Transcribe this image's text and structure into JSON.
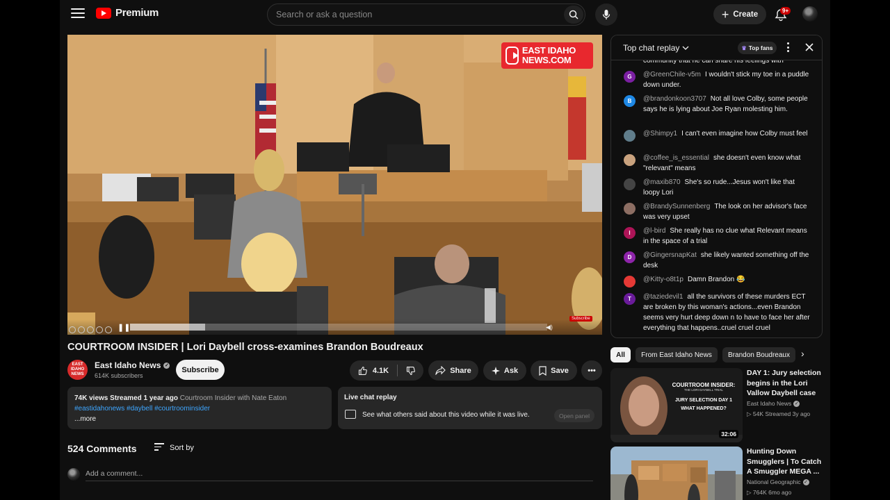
{
  "header": {
    "logo_text": "Premium",
    "search_placeholder": "Search or ask a question",
    "create_label": "Create",
    "notification_badge": "9+"
  },
  "video": {
    "brand_overlay": "EAST IDAHO NEWS.COM",
    "progress_fraction": 0.18,
    "subscribe_watermark": "Subscribe"
  },
  "title": "COURTROOM INSIDER | Lori Daybell cross-examines Brandon Boudreaux",
  "channel": {
    "name": "East Idaho News",
    "subscribers": "614K subscribers",
    "avatar_text": "EAST IDAHO NEWS"
  },
  "actions": {
    "subscribe": "Subscribe",
    "likes": "4.1K",
    "share": "Share",
    "ask": "Ask",
    "save": "Save"
  },
  "description": {
    "views": "74K views",
    "streamed": "Streamed 1 year ago",
    "series": "Courtroom Insider with Nate Eaton",
    "tags": "#eastidahonews #daybell #courtroominsider",
    "more": "...more"
  },
  "live_chat_replay": {
    "title": "Live chat replay",
    "text": "See what others said about this video while it was live.",
    "button": "Open panel"
  },
  "comments": {
    "count": "524 Comments",
    "sort_label": "Sort by",
    "add_placeholder": "Add a comment..."
  },
  "chat": {
    "title": "Top chat replay",
    "top_fans": "Top fans",
    "partial_top": "community that he can share his feelings with",
    "messages": [
      {
        "initial": "G",
        "color": "#7b1fa2",
        "author": "@GreenChile-v5m",
        "text": "I wouldn't stick my toe in a puddle down under."
      },
      {
        "initial": "B",
        "color": "#1e88e5",
        "author": "@brandonkoon3707",
        "text": "Not all love Colby, some people says he is lying about Joe Ryan molesting him."
      },
      {
        "initial": "",
        "color": "#607d8b",
        "author": "@Shimpy1",
        "text": "I can't even imagine how Colby must feel"
      },
      {
        "initial": "",
        "color": "#c9a27e",
        "author": "@coffee_is_essential",
        "text": "she doesn't even know what \"relevant\" means"
      },
      {
        "initial": "",
        "color": "#444444",
        "author": "@maxib870",
        "text": "She's so rude...Jesus won't like that loopy Lori"
      },
      {
        "initial": "",
        "color": "#8d6e63",
        "author": "@BrandySunnenberg",
        "text": "The look on her advisor's face was very upset"
      },
      {
        "initial": "I",
        "color": "#ad1457",
        "author": "@l-bird",
        "text": "She really has no clue what Relevant means in the space of a trial"
      },
      {
        "initial": "D",
        "color": "#8e24aa",
        "author": "@GingersnapKat",
        "text": "she likely wanted something off the desk"
      },
      {
        "initial": "",
        "color": "#e53935",
        "author": "@Kitty-o8t1p",
        "text": "Damn Brandon 😂"
      },
      {
        "initial": "T",
        "color": "#6a1b9a",
        "author": "@taziedevil1",
        "text": "all the survivors of these murders ECT are broken by this woman's actions...even Brandon seems very hurt deep down n to have to face her after everything that happens..cruel cruel cruel"
      }
    ]
  },
  "chips": [
    "All",
    "From East Idaho News",
    "Brandon Boudreaux"
  ],
  "related": [
    {
      "title": "DAY 1: Jury selection begins in the Lori Vallow Daybell case",
      "channel": "East Idaho News",
      "views": "54K",
      "age": "Streamed 3y ago",
      "duration": "32:06",
      "thumb_line1": "COURTROOM INSIDER:",
      "thumb_line2": "THE LORI DAYBELL TRIAL",
      "thumb_line3": "JURY SELECTION DAY 1",
      "thumb_line4": "WHAT HAPPENED?"
    },
    {
      "title": "Hunting Down Smugglers | To Catch A Smuggler MEGA ...",
      "channel": "National Geographic",
      "views": "764K",
      "age": "6mo ago"
    }
  ],
  "colors": {
    "accent_red": "#ff0000",
    "link_blue": "#3ea6ff",
    "background": "#0f0f0f"
  }
}
